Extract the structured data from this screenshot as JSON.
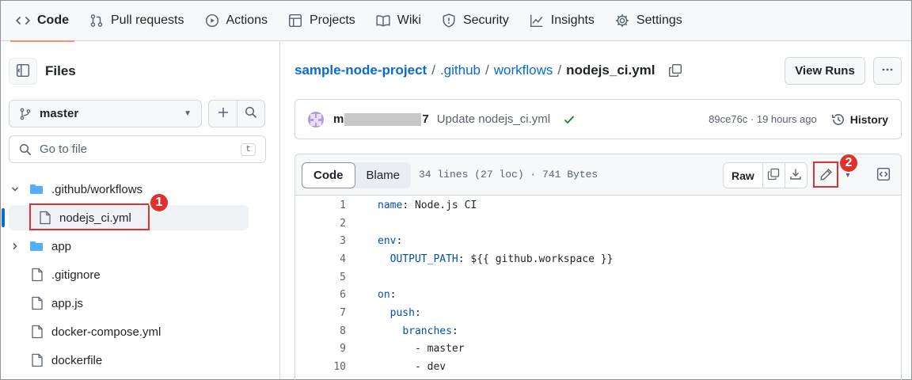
{
  "nav": {
    "tabs": [
      {
        "label": "Code",
        "icon": "code-icon"
      },
      {
        "label": "Pull requests",
        "icon": "pull-request-icon"
      },
      {
        "label": "Actions",
        "icon": "play-icon"
      },
      {
        "label": "Projects",
        "icon": "table-icon"
      },
      {
        "label": "Wiki",
        "icon": "book-icon"
      },
      {
        "label": "Security",
        "icon": "shield-icon"
      },
      {
        "label": "Insights",
        "icon": "graph-icon"
      },
      {
        "label": "Settings",
        "icon": "gear-icon"
      }
    ],
    "active": "Code"
  },
  "sidebar": {
    "title": "Files",
    "branch": "master",
    "search_placeholder": "Go to file",
    "search_shortcut": "t",
    "tree": [
      {
        "name": ".github/workflows",
        "type": "folder",
        "expanded": true
      },
      {
        "name": "nodejs_ci.yml",
        "type": "file",
        "selected": true
      },
      {
        "name": "app",
        "type": "folder",
        "expanded": false
      },
      {
        "name": ".gitignore",
        "type": "file"
      },
      {
        "name": "app.js",
        "type": "file"
      },
      {
        "name": "docker-compose.yml",
        "type": "file"
      },
      {
        "name": "dockerfile",
        "type": "file"
      }
    ]
  },
  "breadcrumb": {
    "repo": "sample-node-project",
    "sep": "/",
    "dir1": ".github",
    "dir2": "workflows",
    "file": "nodejs_ci.yml"
  },
  "view_runs_label": "View Runs",
  "commit": {
    "author_start": "m",
    "author_end": "7",
    "message": "Update nodejs_ci.yml",
    "sha_time": "89ce76c · 19 hours ago",
    "history_label": "History"
  },
  "file": {
    "tab_code": "Code",
    "tab_blame": "Blame",
    "info": "34 lines (27 loc) · 741 Bytes",
    "raw_label": "Raw",
    "lines": [
      {
        "n": "1",
        "key": "name",
        "rest": ": Node.js CI",
        "indent": ""
      },
      {
        "n": "2",
        "key": "",
        "rest": "",
        "indent": ""
      },
      {
        "n": "3",
        "key": "env",
        "rest": ":",
        "indent": ""
      },
      {
        "n": "4",
        "key": "OUTPUT_PATH",
        "rest": ": ${{ github.workspace }}",
        "indent": "  "
      },
      {
        "n": "5",
        "key": "",
        "rest": "",
        "indent": ""
      },
      {
        "n": "6",
        "key": "on",
        "rest": ":",
        "indent": ""
      },
      {
        "n": "7",
        "key": "push",
        "rest": ":",
        "indent": "  "
      },
      {
        "n": "8",
        "key": "branches",
        "rest": ":",
        "indent": "    "
      },
      {
        "n": "9",
        "key": "",
        "rest": "- master",
        "indent": "      "
      },
      {
        "n": "10",
        "key": "",
        "rest": "- dev",
        "indent": "      "
      }
    ]
  },
  "annotations": {
    "badge1": "1",
    "badge2": "2",
    "color": "#e0312e"
  }
}
